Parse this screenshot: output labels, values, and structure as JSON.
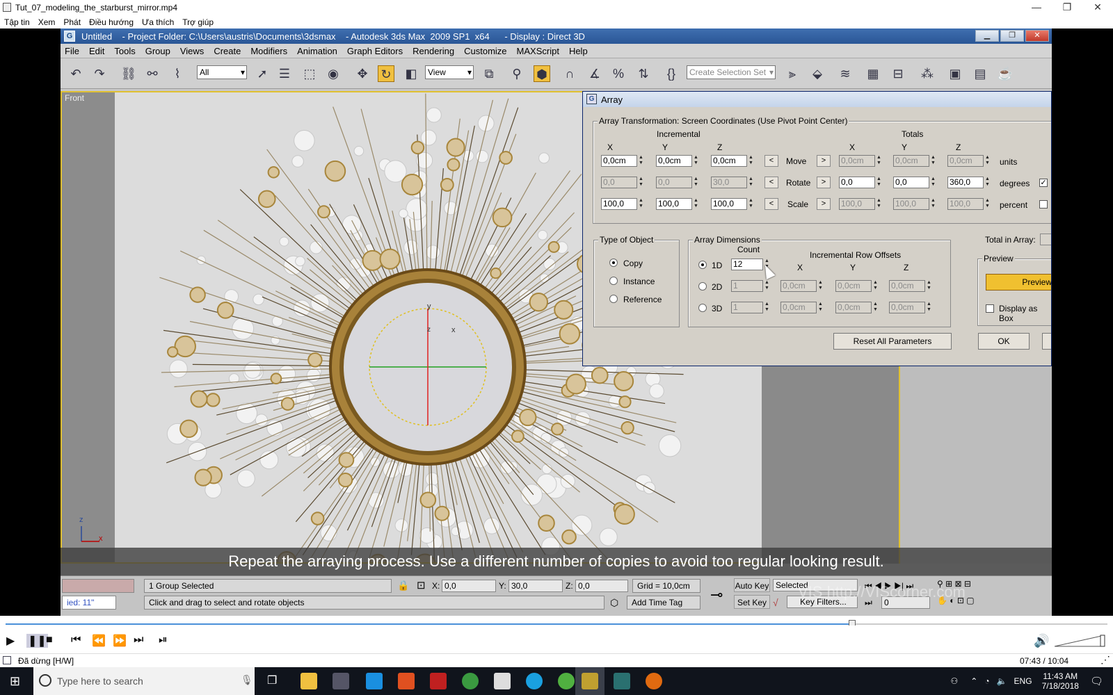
{
  "player": {
    "title": "Tut_07_modeling_the_starburst_mirror.mp4",
    "menu": [
      "Tập tin",
      "Xem",
      "Phát",
      "Điều hướng",
      "Ưa thích",
      "Trợ giúp"
    ],
    "win_buttons": [
      "—",
      "❐",
      "✕"
    ],
    "status": "Đã dừng [H/W]",
    "time": "07:43 / 10:04",
    "progress": 0.768
  },
  "max": {
    "title": "Untitled    - Project Folder: C:\\Users\\austris\\Documents\\3dsmax    - Autodesk 3ds Max  2009 SP1  x64      - Display : Direct 3D",
    "menu": [
      "File",
      "Edit",
      "Tools",
      "Group",
      "Views",
      "Create",
      "Modifiers",
      "Animation",
      "Graph Editors",
      "Rendering",
      "Customize",
      "MAXScript",
      "Help"
    ],
    "toolbar": {
      "selection_filter": "All",
      "ref_coord": "View",
      "named_selection": "Create Selection Set"
    },
    "viewport_label": "Front",
    "axis_y": "y",
    "axis_z": "z",
    "axis_x": "x",
    "corner_z": "z",
    "corner_x": "x"
  },
  "subtitle": "Repeat the arraying process. Use a different number of copies to avoid too regular looking result.",
  "status": {
    "selection": "1 Group Selected",
    "prompt": "Click and drag to select and rotate objects",
    "left_field": "ied: 11\"",
    "x_label": "X:",
    "x": "0,0",
    "y_label": "Y:",
    "y": "30,0",
    "z_label": "Z:",
    "z": "0,0",
    "grid": "Grid = 10,0cm",
    "add_time_tag": "Add Time Tag",
    "auto_key": "Auto Key",
    "set_key": "Set Key",
    "key_mode": "Selected",
    "key_filters": "Key Filters...",
    "frame": "0",
    "watermark": "VIS http://VIScorner.com"
  },
  "array_dialog": {
    "title": "Array",
    "transform_group": "Array Transformation: Screen Coordinates (Use Pivot Point Center)",
    "incremental": "Incremental",
    "totals": "Totals",
    "x": "X",
    "y": "Y",
    "z": "Z",
    "rows": [
      {
        "label": "Move",
        "inc": [
          "0,0cm",
          "0,0cm",
          "0,0cm"
        ],
        "tot": [
          "0,0cm",
          "0,0cm",
          "0,0cm"
        ],
        "unit": "units",
        "checkbox": null
      },
      {
        "label": "Rotate",
        "inc": [
          "0,0",
          "0,0",
          "30,0"
        ],
        "tot": [
          "0,0",
          "0,0",
          "360,0"
        ],
        "unit": "degrees",
        "checkbox": true
      },
      {
        "label": "Scale",
        "inc": [
          "100,0",
          "100,0",
          "100,0"
        ],
        "tot": [
          "100,0",
          "100,0",
          "100,0"
        ],
        "unit": "percent",
        "checkbox": false
      }
    ],
    "type_group": "Type of Object",
    "types": [
      "Copy",
      "Instance",
      "Reference"
    ],
    "selected_type": "Copy",
    "dims_group": "Array Dimensions",
    "count_label": "Count",
    "row_offsets": "Incremental Row Offsets",
    "dims": [
      {
        "label": "1D",
        "count": "12",
        "offsets": null
      },
      {
        "label": "2D",
        "count": "1",
        "offsets": [
          "0,0cm",
          "0,0cm",
          "0,0cm"
        ]
      },
      {
        "label": "3D",
        "count": "1",
        "offsets": [
          "0,0cm",
          "0,0cm",
          "0,0cm"
        ]
      }
    ],
    "total_label": "Total in Array:",
    "preview_group": "Preview",
    "preview_btn": "Preview",
    "display_as_box": "Display as Box",
    "reset": "Reset All Parameters",
    "ok": "OK",
    "arrow_left": "<",
    "arrow_right": ">"
  },
  "taskbar": {
    "search_placeholder": "Type here to search",
    "lang": "ENG",
    "time": "11:43 AM",
    "date": "7/18/2018"
  }
}
